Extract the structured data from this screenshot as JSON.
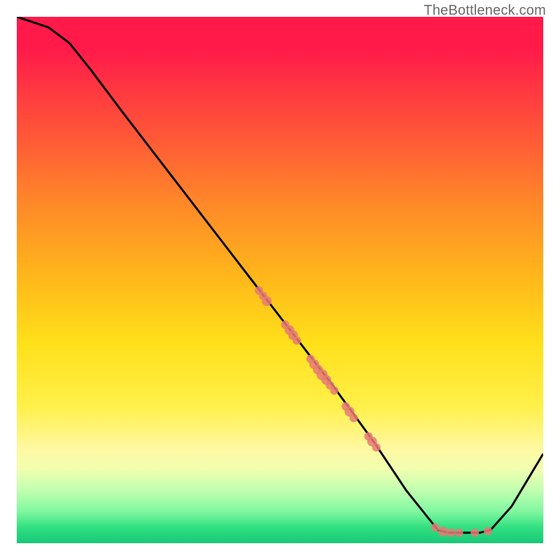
{
  "watermark": "TheBottleneck.com",
  "chart_data": {
    "type": "line",
    "title": "",
    "xlabel": "",
    "ylabel": "",
    "xlim": [
      0,
      100
    ],
    "ylim": [
      0,
      100
    ],
    "curve": [
      {
        "x": 0,
        "y": 100
      },
      {
        "x": 6,
        "y": 98
      },
      {
        "x": 10,
        "y": 95
      },
      {
        "x": 14,
        "y": 90
      },
      {
        "x": 20,
        "y": 82
      },
      {
        "x": 30,
        "y": 69
      },
      {
        "x": 40,
        "y": 56
      },
      {
        "x": 50,
        "y": 43
      },
      {
        "x": 60,
        "y": 30
      },
      {
        "x": 68,
        "y": 19
      },
      {
        "x": 74,
        "y": 10
      },
      {
        "x": 78,
        "y": 5
      },
      {
        "x": 80,
        "y": 2.5
      },
      {
        "x": 82,
        "y": 2
      },
      {
        "x": 88,
        "y": 2
      },
      {
        "x": 90,
        "y": 2.5
      },
      {
        "x": 94,
        "y": 7
      },
      {
        "x": 100,
        "y": 17
      }
    ],
    "scatter_clusters": [
      {
        "x": 46.0,
        "y": 48.0,
        "r": 6
      },
      {
        "x": 46.8,
        "y": 47.0,
        "r": 6
      },
      {
        "x": 47.5,
        "y": 46.0,
        "r": 7
      },
      {
        "x": 51.0,
        "y": 41.5,
        "r": 6
      },
      {
        "x": 51.8,
        "y": 40.5,
        "r": 7
      },
      {
        "x": 52.5,
        "y": 39.5,
        "r": 7
      },
      {
        "x": 53.2,
        "y": 38.5,
        "r": 6
      },
      {
        "x": 55.8,
        "y": 35.0,
        "r": 6
      },
      {
        "x": 56.5,
        "y": 34.0,
        "r": 7
      },
      {
        "x": 57.2,
        "y": 33.0,
        "r": 7
      },
      {
        "x": 58.0,
        "y": 32.0,
        "r": 8
      },
      {
        "x": 58.8,
        "y": 31.0,
        "r": 7
      },
      {
        "x": 59.5,
        "y": 30.0,
        "r": 6
      },
      {
        "x": 60.3,
        "y": 29.0,
        "r": 6
      },
      {
        "x": 62.5,
        "y": 26.0,
        "r": 6
      },
      {
        "x": 63.2,
        "y": 25.0,
        "r": 7
      },
      {
        "x": 64.0,
        "y": 23.8,
        "r": 6
      },
      {
        "x": 66.8,
        "y": 20.3,
        "r": 6
      },
      {
        "x": 67.5,
        "y": 19.3,
        "r": 7
      },
      {
        "x": 68.3,
        "y": 18.2,
        "r": 6
      },
      {
        "x": 79.5,
        "y": 3.0,
        "r": 6
      },
      {
        "x": 81.0,
        "y": 2.2,
        "r": 7
      },
      {
        "x": 82.5,
        "y": 2.0,
        "r": 6
      },
      {
        "x": 84.0,
        "y": 2.0,
        "r": 6
      },
      {
        "x": 87.0,
        "y": 2.0,
        "r": 6
      },
      {
        "x": 89.5,
        "y": 2.3,
        "r": 6
      }
    ],
    "colors": {
      "curve": "#000000",
      "scatter": "#e77a74"
    }
  }
}
